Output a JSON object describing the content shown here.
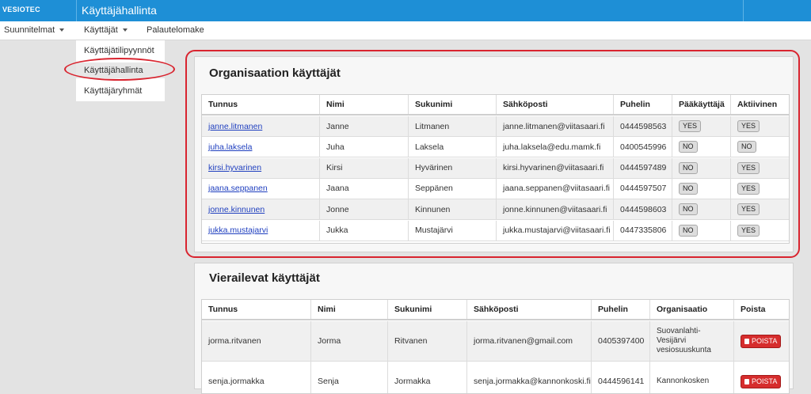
{
  "header": {
    "brand": "VESIOTEC",
    "title": "Käyttäjähallinta"
  },
  "menu": {
    "items": [
      {
        "label": "Suunnitelmat",
        "has_caret": true
      },
      {
        "label": "Käyttäjät",
        "has_caret": true
      },
      {
        "label": "Palautelomake",
        "has_caret": false
      }
    ],
    "dropdown": [
      "Käyttäjätilipyynnöt",
      "Käyttäjähallinta",
      "Käyttäjäryhmät"
    ],
    "active_dropdown_index": 1
  },
  "org_users": {
    "title": "Organisaation käyttäjät",
    "columns": [
      "Tunnus",
      "Nimi",
      "Sukunimi",
      "Sähköposti",
      "Puhelin",
      "Pääkäyttäjä",
      "Aktiivinen"
    ],
    "rows": [
      {
        "tunnus": "janne.litmanen",
        "nimi": "Janne",
        "sukunimi": "Litmanen",
        "email": "janne.litmanen@viitasaari.fi",
        "puhelin": "0444598563",
        "paakayttaja": "YES",
        "aktiivinen": "YES"
      },
      {
        "tunnus": "juha.laksela",
        "nimi": "Juha",
        "sukunimi": "Laksela",
        "email": "juha.laksela@edu.mamk.fi",
        "puhelin": "0400545996",
        "paakayttaja": "NO",
        "aktiivinen": "NO"
      },
      {
        "tunnus": "kirsi.hyvarinen",
        "nimi": "Kirsi",
        "sukunimi": "Hyvärinen",
        "email": "kirsi.hyvarinen@viitasaari.fi",
        "puhelin": "0444597489",
        "paakayttaja": "NO",
        "aktiivinen": "YES"
      },
      {
        "tunnus": "jaana.seppanen",
        "nimi": "Jaana",
        "sukunimi": "Seppänen",
        "email": "jaana.seppanen@viitasaari.fi",
        "puhelin": "0444597507",
        "paakayttaja": "NO",
        "aktiivinen": "YES"
      },
      {
        "tunnus": "jonne.kinnunen",
        "nimi": "Jonne",
        "sukunimi": "Kinnunen",
        "email": "jonne.kinnunen@viitasaari.fi",
        "puhelin": "0444598603",
        "paakayttaja": "NO",
        "aktiivinen": "YES"
      },
      {
        "tunnus": "jukka.mustajarvi",
        "nimi": "Jukka",
        "sukunimi": "Mustajärvi",
        "email": "jukka.mustajarvi@viitasaari.fi",
        "puhelin": "0447335806",
        "paakayttaja": "NO",
        "aktiivinen": "YES"
      }
    ]
  },
  "visiting_users": {
    "title": "Vierailevat käyttäjät",
    "columns": [
      "Tunnus",
      "Nimi",
      "Sukunimi",
      "Sähköposti",
      "Puhelin",
      "Organisaatio",
      "Poista"
    ],
    "delete_label": "POISTA",
    "rows": [
      {
        "tunnus": "jorma.ritvanen",
        "nimi": "Jorma",
        "sukunimi": "Ritvanen",
        "email": "jorma.ritvanen@gmail.com",
        "puhelin": "0405397400",
        "organisaatio": "Suovanlahti-Vesijärvi vesiosuuskunta"
      },
      {
        "tunnus": "senja.jormakka",
        "nimi": "Senja",
        "sukunimi": "Jormakka",
        "email": "senja.jormakka@kannonkoski.fi",
        "puhelin": "0444596141",
        "organisaatio": "Kannonkosken"
      }
    ]
  },
  "colors": {
    "topbar": "#1e8fd6",
    "annotation": "#d9242f",
    "delete": "#d62d2d",
    "link": "#1f3fbf"
  }
}
